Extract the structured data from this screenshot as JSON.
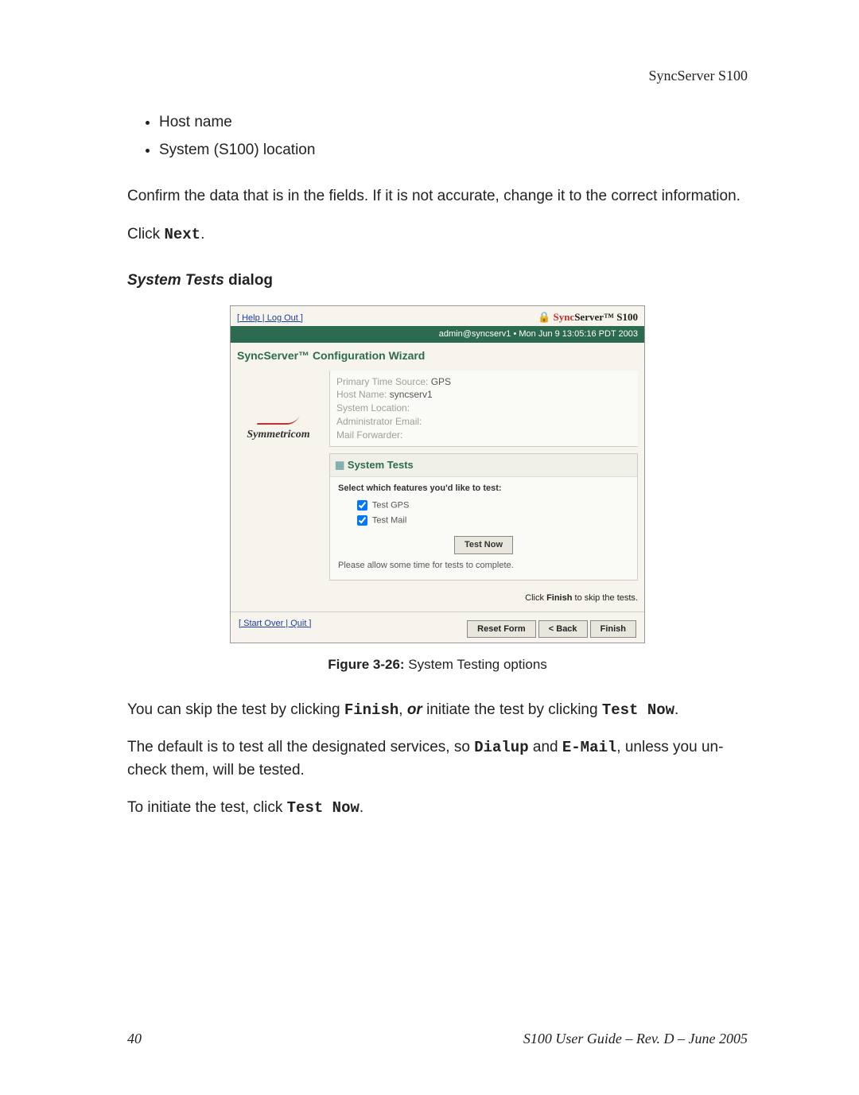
{
  "header": {
    "product": "SyncServer S100"
  },
  "bullets": [
    "Host name",
    "System (S100) location"
  ],
  "para_confirm": "Confirm the data that is in the fields. If it is not accurate, change it to the correct information.",
  "para_click": "Click ",
  "next_label": "Next",
  "period": ".",
  "section": {
    "italic": "System Tests",
    "rest": " dialog"
  },
  "wizard": {
    "toplinks": "[ Help | Log Out ]",
    "brand_pre": "Sync",
    "brand_rest": "Server™ S100",
    "status_bar": "admin@syncserv1  •  Mon Jun 9 13:05:16 PDT 2003",
    "wiz_title": "SyncServer™ Configuration Wizard",
    "logo_text": "Symmetricom",
    "info": {
      "l1_k": "Primary Time Source:",
      "l1_v": " GPS",
      "l2_k": "Host Name:",
      "l2_v": " syncserv1",
      "l3": "System Location:",
      "l4": "Administrator Email:",
      "l5": "Mail Forwarder:"
    },
    "systests_title": "System Tests",
    "select_label": "Select which features you'd like to test:",
    "cb1": "Test GPS",
    "cb2": "Test Mail",
    "test_now": "Test Now",
    "wait": "Please allow some time for tests to complete.",
    "skip_hint_pre": "Click ",
    "skip_hint_bold": "Finish",
    "skip_hint_post": " to skip the tests.",
    "footer_links": "[ Start Over | Quit ]",
    "btn_reset": "Reset Form",
    "btn_back": "< Back",
    "btn_finish": "Finish"
  },
  "figure": {
    "num": "Figure 3-26:",
    "text": "  System Testing options"
  },
  "after1_a": "You can skip the test by clicking ",
  "after1_b": "Finish",
  "after1_c": ", ",
  "after1_or": "or",
  "after1_d": " initiate the test by clicking ",
  "after1_e": "Test Now",
  "after1_f": ".",
  "after2_a": "The default is to test all the designated services, so ",
  "after2_b": "Dialup",
  "after2_c": " and ",
  "after2_d": "E-Mail",
  "after2_e": ", unless you un-check them, will be tested.",
  "after3_a": "To initiate the test, click ",
  "after3_b": "Test Now",
  "after3_c": ".",
  "footer": {
    "pagenum": "40",
    "guide": "S100 User Guide – Rev. D – June 2005"
  }
}
